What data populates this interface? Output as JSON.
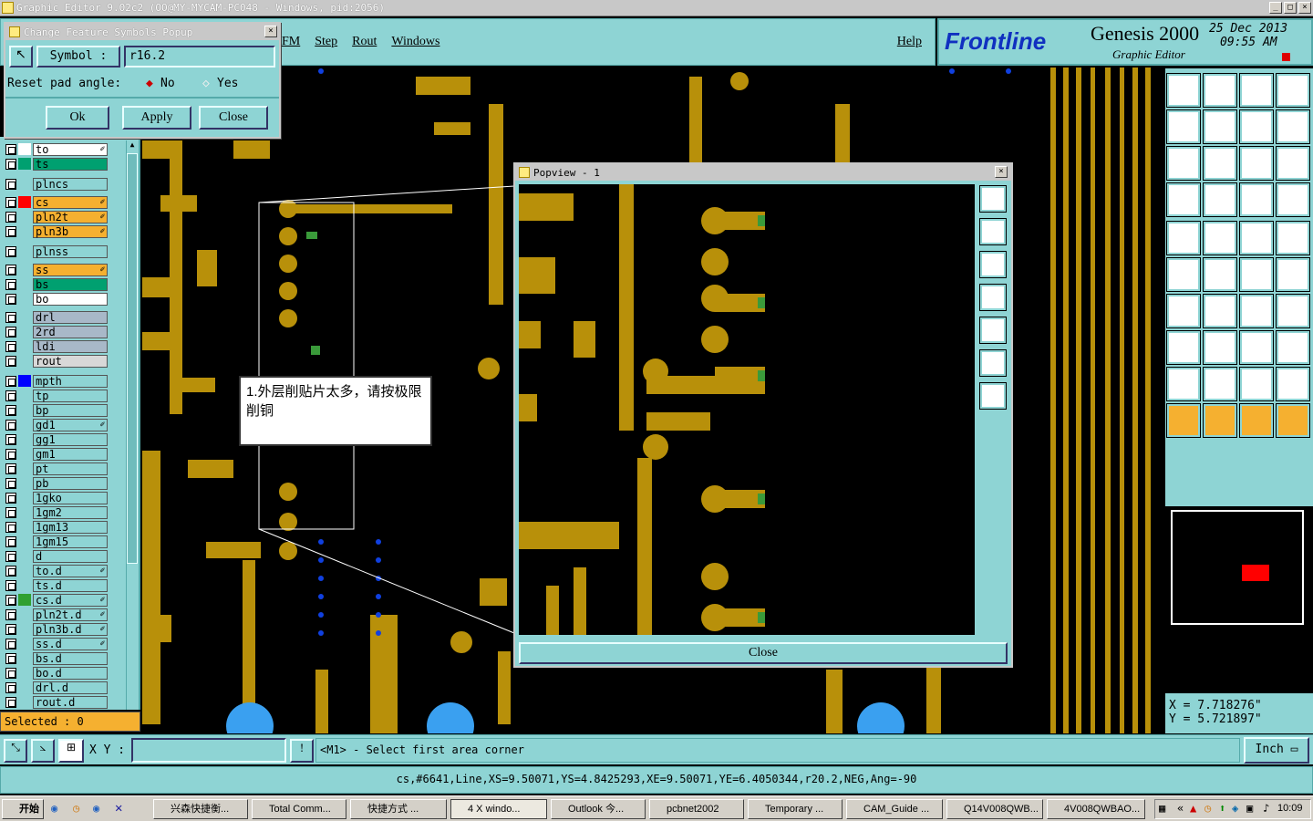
{
  "window": {
    "title": "Graphic Editor 9.02c2 (OO@MY-MYCAM-PC048 - Windows, pid:2056)"
  },
  "menu": [
    "FM",
    "Step",
    "Rout",
    "Windows"
  ],
  "help": "Help",
  "brand": {
    "logo": "Frontline",
    "product": "Genesis 2000",
    "sub": "Graphic Editor",
    "date": "25 Dec 2013",
    "time": "09:55 AM"
  },
  "popup": {
    "title": "Change Feature Symbols Popup",
    "symbol_label": "Symbol :",
    "symbol_value": "r16.2",
    "reset_label": "Reset pad angle:",
    "opt_no": "No",
    "opt_yes": "Yes",
    "ok": "Ok",
    "apply": "Apply",
    "close": "Close"
  },
  "layers": [
    {
      "name": "to",
      "color": "#ffffff",
      "bg": "#ffffff",
      "edit": true
    },
    {
      "name": "ts",
      "color": "#00a070",
      "bg": "#00a070",
      "edit": false
    },
    {
      "name": "plncs",
      "color": "#8ed4d4",
      "bg": "#8ed4d4",
      "edit": false
    },
    {
      "name": "cs",
      "color": "#ff0000",
      "bg": "#f5b030",
      "edit": true
    },
    {
      "name": "pln2t",
      "color": "#8ed4d4",
      "bg": "#f5b030",
      "edit": true
    },
    {
      "name": "pln3b",
      "color": "#8ed4d4",
      "bg": "#f5b030",
      "edit": true
    },
    {
      "name": "plnss",
      "color": "#8ed4d4",
      "bg": "#8ed4d4",
      "edit": false
    },
    {
      "name": "ss",
      "color": "#8ed4d4",
      "bg": "#f5b030",
      "edit": true
    },
    {
      "name": "bs",
      "color": "#8ed4d4",
      "bg": "#00a070",
      "edit": false
    },
    {
      "name": "bo",
      "color": "#8ed4d4",
      "bg": "#ffffff",
      "edit": false
    },
    {
      "name": "drl",
      "color": "#8ed4d4",
      "bg": "#a8b8c8",
      "edit": false
    },
    {
      "name": "2rd",
      "color": "#8ed4d4",
      "bg": "#a8b8c8",
      "edit": false
    },
    {
      "name": "ldi",
      "color": "#8ed4d4",
      "bg": "#a8b8c8",
      "edit": false
    },
    {
      "name": "rout",
      "color": "#8ed4d4",
      "bg": "#d8d8d8",
      "edit": false
    },
    {
      "name": "mpth",
      "color": "#0000ff",
      "bg": "#8ed4d4",
      "edit": false
    },
    {
      "name": "tp",
      "color": "#8ed4d4",
      "bg": "#8ed4d4",
      "edit": false
    },
    {
      "name": "bp",
      "color": "#8ed4d4",
      "bg": "#8ed4d4",
      "edit": false
    },
    {
      "name": "gd1",
      "color": "#8ed4d4",
      "bg": "#8ed4d4",
      "edit": true
    },
    {
      "name": "gg1",
      "color": "#8ed4d4",
      "bg": "#8ed4d4",
      "edit": false
    },
    {
      "name": "gm1",
      "color": "#8ed4d4",
      "bg": "#8ed4d4",
      "edit": false
    },
    {
      "name": "pt",
      "color": "#8ed4d4",
      "bg": "#8ed4d4",
      "edit": false
    },
    {
      "name": "pb",
      "color": "#8ed4d4",
      "bg": "#8ed4d4",
      "edit": false
    },
    {
      "name": "1gko",
      "color": "#8ed4d4",
      "bg": "#8ed4d4",
      "edit": false
    },
    {
      "name": "1gm2",
      "color": "#8ed4d4",
      "bg": "#8ed4d4",
      "edit": false
    },
    {
      "name": "1gm13",
      "color": "#8ed4d4",
      "bg": "#8ed4d4",
      "edit": false
    },
    {
      "name": "1gm15",
      "color": "#8ed4d4",
      "bg": "#8ed4d4",
      "edit": false
    },
    {
      "name": "d",
      "color": "#8ed4d4",
      "bg": "#8ed4d4",
      "edit": false
    },
    {
      "name": "to.d",
      "color": "#8ed4d4",
      "bg": "#8ed4d4",
      "edit": true
    },
    {
      "name": "ts.d",
      "color": "#8ed4d4",
      "bg": "#8ed4d4",
      "edit": false
    },
    {
      "name": "cs.d",
      "color": "#30a030",
      "bg": "#8ed4d4",
      "edit": true
    },
    {
      "name": "pln2t.d",
      "color": "#8ed4d4",
      "bg": "#8ed4d4",
      "edit": true
    },
    {
      "name": "pln3b.d",
      "color": "#8ed4d4",
      "bg": "#8ed4d4",
      "edit": true
    },
    {
      "name": "ss.d",
      "color": "#8ed4d4",
      "bg": "#8ed4d4",
      "edit": true
    },
    {
      "name": "bs.d",
      "color": "#8ed4d4",
      "bg": "#8ed4d4",
      "edit": false
    },
    {
      "name": "bo.d",
      "color": "#8ed4d4",
      "bg": "#8ed4d4",
      "edit": false
    },
    {
      "name": "drl.d",
      "color": "#8ed4d4",
      "bg": "#8ed4d4",
      "edit": false
    },
    {
      "name": "rout.d",
      "color": "#8ed4d4",
      "bg": "#8ed4d4",
      "edit": false
    }
  ],
  "selected": "Selected : 0",
  "note": "1.外层削贴片太多，请按极限削铜",
  "popview": {
    "title": "Popview - 1",
    "close": "Close"
  },
  "coords": {
    "x": "X = 7.718276\"",
    "y": "Y = 5.721897\""
  },
  "xy_label": "X Y :",
  "prompt": "<M1> - Select first area corner",
  "units": "Inch",
  "feature_info": "cs,#6641,Line,XS=9.50071,YS=4.8425293,XE=9.50071,YE=6.4050344,r20.2,NEG,Ang=-90",
  "taskbar": {
    "start": "开始",
    "tasks": [
      "兴森快捷衡...",
      "Total Comm...",
      "快捷方式 ...",
      "4 X windo...",
      "Outlook 今...",
      "pcbnet2002",
      "Temporary ...",
      "CAM_Guide ...",
      "Q14V008QWB...",
      "4V008QWBAO..."
    ],
    "clock": "10:09"
  },
  "colors": {
    "teal": "#8ed4d4",
    "copper": "#b8900a",
    "blue": "#1040e0"
  }
}
